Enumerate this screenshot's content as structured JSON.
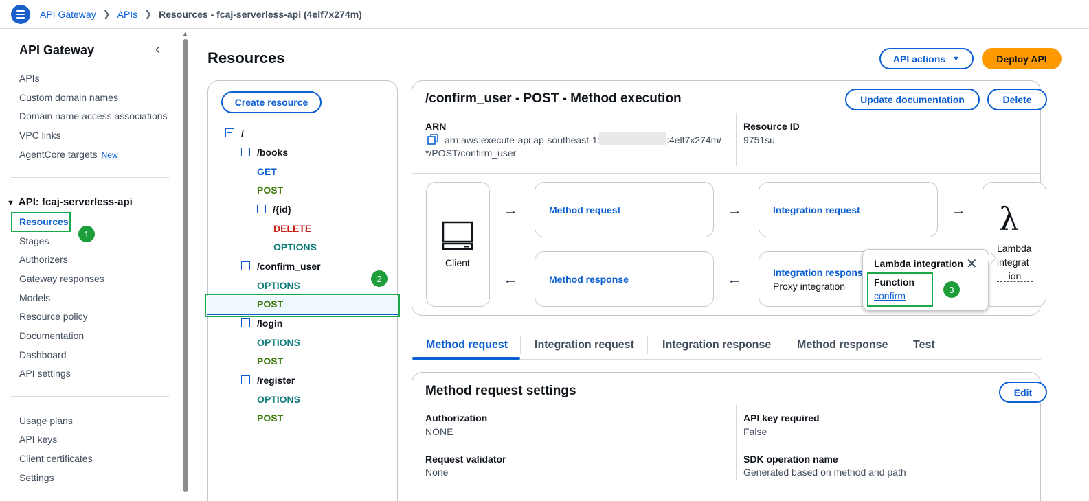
{
  "breadcrumb": {
    "items": [
      "API Gateway",
      "APIs"
    ],
    "current": "Resources - fcaj-serverless-api (4elf7x274m)"
  },
  "sidebar": {
    "title": "API Gateway",
    "links_top": [
      "APIs",
      "Custom domain names",
      "Domain name access associations",
      "VPC links",
      "AgentCore targets"
    ],
    "new_badge": "New",
    "group_title": "API: fcaj-serverless-api",
    "group_items": [
      "Resources",
      "Stages",
      "Authorizers",
      "Gateway responses",
      "Models",
      "Resource policy",
      "Documentation",
      "Dashboard",
      "API settings"
    ],
    "links_bottom": [
      "Usage plans",
      "API keys",
      "Client certificates",
      "Settings"
    ]
  },
  "annotations": [
    "1",
    "2",
    "3"
  ],
  "header": {
    "title": "Resources",
    "api_actions_label": "API actions",
    "deploy_label": "Deploy API"
  },
  "tree": {
    "create_label": "Create resource",
    "root": "/",
    "books": "/books",
    "books_get": "GET",
    "books_post": "POST",
    "id": "/{id}",
    "id_delete": "DELETE",
    "id_options": "OPTIONS",
    "confirm": "/confirm_user",
    "confirm_options": "OPTIONS",
    "confirm_post": "POST",
    "login": "/login",
    "login_options": "OPTIONS",
    "login_post": "POST",
    "register": "/register",
    "register_options": "OPTIONS",
    "register_post": "POST"
  },
  "execution": {
    "title": "/confirm_user - POST - Method execution",
    "update_doc_label": "Update documentation",
    "delete_label": "Delete",
    "arn_label": "ARN",
    "arn_line1_a": "arn:aws:execute-api:ap-southeast-1:",
    "arn_line1_b": ":4elf7x274m/",
    "arn_line2": "*/POST/confirm_user",
    "resource_id_label": "Resource ID",
    "resource_id": "9751su"
  },
  "flow": {
    "client": "Client",
    "method_request": "Method request",
    "integration_request": "Integration request",
    "method_response": "Method response",
    "integration_response": "Integration respons",
    "proxy": "Proxy integration",
    "lambda_line1": "Lambda",
    "lambda_line2": "integrat",
    "lambda_line3": "ion"
  },
  "popover": {
    "title": "Lambda integration",
    "function_label": "Function",
    "function_link": "confirm"
  },
  "tabs": [
    "Method request",
    "Integration request",
    "Integration response",
    "Method response",
    "Test"
  ],
  "settings": {
    "title": "Method request settings",
    "edit_label": "Edit",
    "authorization_label": "Authorization",
    "authorization_value": "NONE",
    "api_key_label": "API key required",
    "api_key_value": "False",
    "validator_label": "Request validator",
    "validator_value": "None",
    "sdk_label": "SDK operation name",
    "sdk_value": "Generated based on method and path"
  },
  "colors": {
    "accent": "#0b5fd3",
    "deploy": "#ff9900",
    "annotation_green": "#1d9e3a",
    "post_green": "#3d7a0b",
    "delete_red": "#c9221a"
  }
}
